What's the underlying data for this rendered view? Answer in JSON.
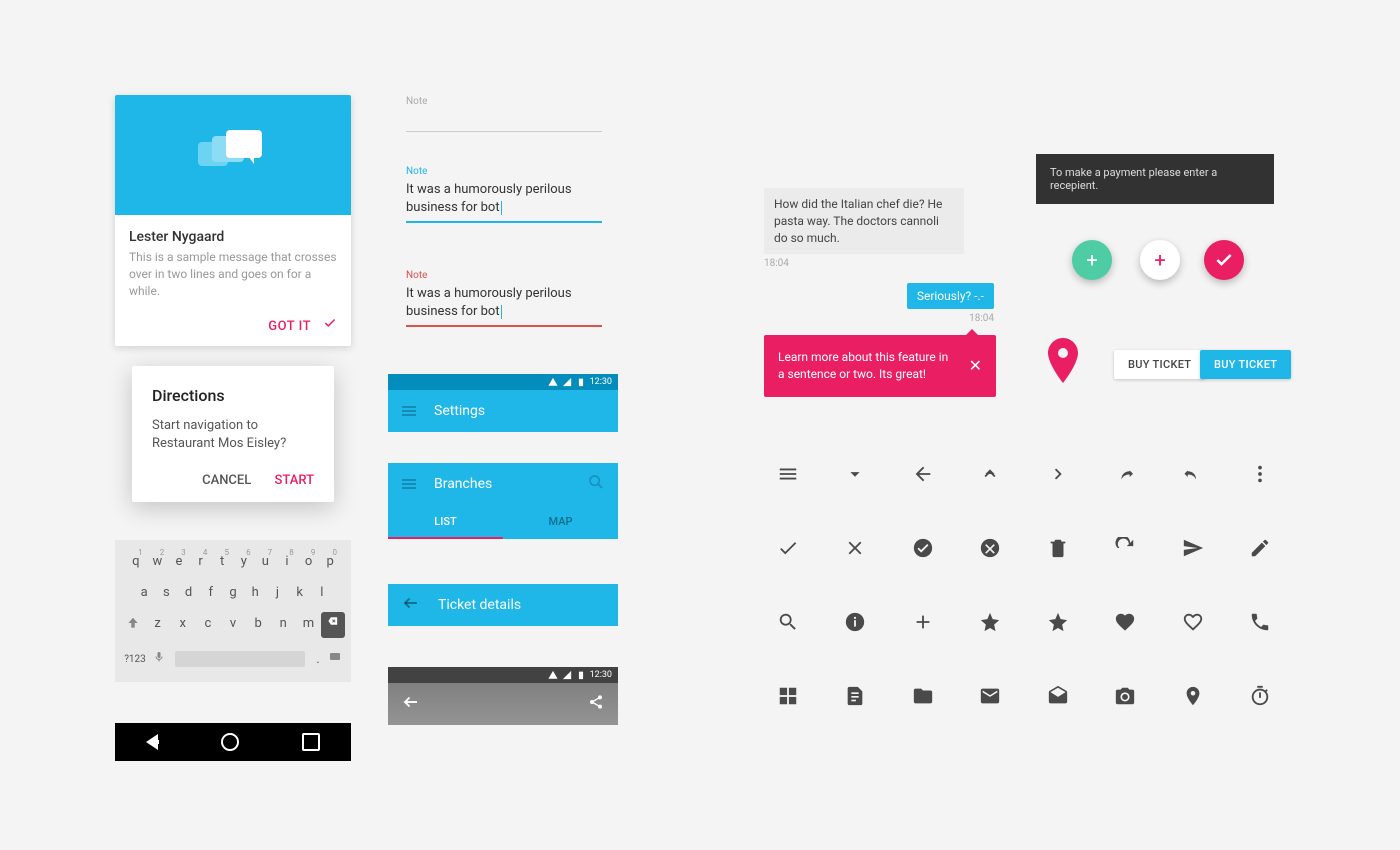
{
  "card": {
    "title": "Lester Nygaard",
    "text": "This is a sample message that crosses over in two lines and goes on for a while.",
    "action": "GOT IT"
  },
  "dialog": {
    "title": "Directions",
    "text": "Start navigation to Restaurant Mos Eisley?",
    "cancel": "CANCEL",
    "confirm": "START"
  },
  "keyboard": {
    "row1": [
      "q",
      "w",
      "e",
      "r",
      "t",
      "y",
      "u",
      "i",
      "o",
      "p"
    ],
    "row1sup": [
      "1",
      "2",
      "3",
      "4",
      "5",
      "6",
      "7",
      "8",
      "9",
      "0"
    ],
    "row2": [
      "a",
      "s",
      "d",
      "f",
      "g",
      "h",
      "j",
      "k",
      "l"
    ],
    "row3": [
      "z",
      "x",
      "c",
      "v",
      "b",
      "n",
      "m"
    ],
    "nums": "?123",
    "dot": "."
  },
  "textfields": {
    "label": "Note",
    "value": "It was a humorously perilous business for bot"
  },
  "appbars": {
    "settings": "Settings",
    "branches": "Branches",
    "tabs": {
      "list": "LIST",
      "map": "MAP"
    },
    "ticket": "Ticket details",
    "time": "12:30"
  },
  "chat": {
    "incoming": "How did the Italian chef die? He pasta way. The doctors cannoli do so much.",
    "outgoing": "Seriously? -.-",
    "time": "18:04"
  },
  "snackbar": "To make a payment please enter a recepient.",
  "tooltip": "Learn more about this feature in a sentence or two. Its great!",
  "buttons": {
    "flat": "BUY TICKET",
    "raised": "BUY TICKET"
  },
  "icons": [
    [
      "hamburger-icon",
      "dropdown-icon",
      "arrow-back-icon",
      "arrow-up-icon",
      "arrow-forward-icon",
      "redo-icon",
      "undo-icon",
      "more-vert-icon"
    ],
    [
      "check-icon",
      "close-icon",
      "check-circle-icon",
      "cancel-circle-icon",
      "delete-icon",
      "refresh-icon",
      "send-icon",
      "edit-icon"
    ],
    [
      "search-icon",
      "info-icon",
      "add-icon",
      "star-icon",
      "star-icon",
      "favorite-icon",
      "favorite-outline-icon",
      "phone-icon"
    ],
    [
      "dashboard-icon",
      "description-icon",
      "folder-icon",
      "mail-icon",
      "drafts-icon",
      "camera-icon",
      "place-icon",
      "timer-icon"
    ]
  ]
}
